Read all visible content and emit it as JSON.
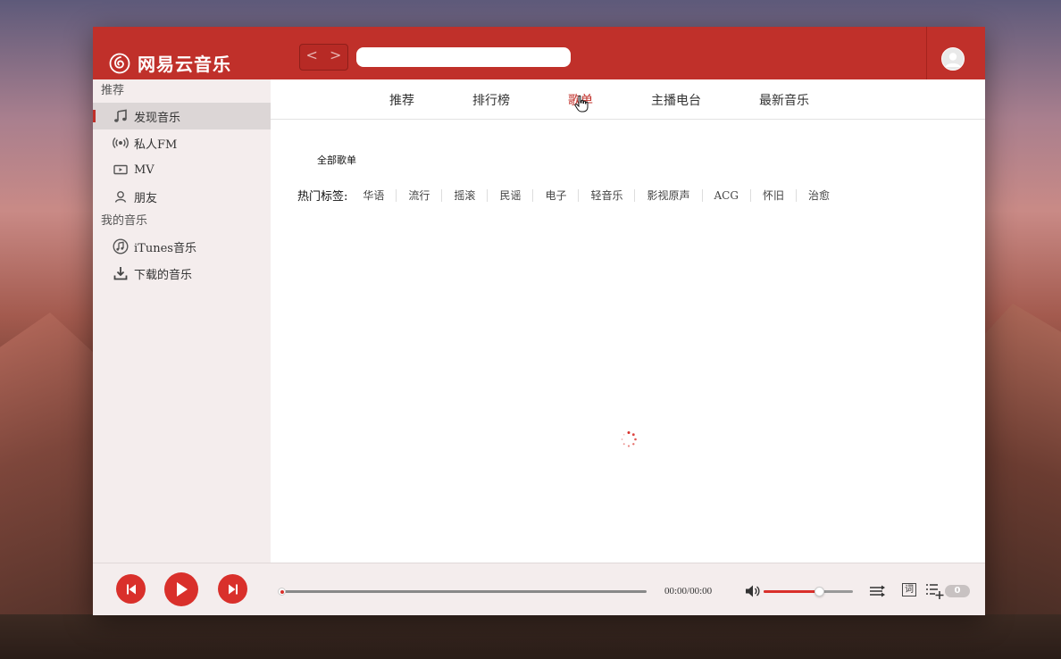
{
  "app": {
    "title": "网易云音乐"
  },
  "header": {
    "nav_back": "<",
    "nav_forward": ">",
    "search": {
      "value": "",
      "placeholder": ""
    }
  },
  "sidebar": {
    "section_recommend": "推荐",
    "recommend_items": [
      {
        "label": "发现音乐",
        "icon": "music-note-icon",
        "active": true
      },
      {
        "label": "私人FM",
        "icon": "radio-icon",
        "active": false
      },
      {
        "label": "MV",
        "icon": "video-icon",
        "active": false
      },
      {
        "label": "朋友",
        "icon": "friends-icon",
        "active": false
      }
    ],
    "section_my_music": "我的音乐",
    "my_music_items": [
      {
        "label": "iTunes音乐",
        "icon": "itunes-icon"
      },
      {
        "label": "下载的音乐",
        "icon": "download-icon"
      }
    ]
  },
  "tabs": [
    {
      "label": "推荐",
      "active": false
    },
    {
      "label": "排行榜",
      "active": false
    },
    {
      "label": "歌单",
      "active": true
    },
    {
      "label": "主播电台",
      "active": false
    },
    {
      "label": "最新音乐",
      "active": false
    }
  ],
  "playlist": {
    "all_label": "全部歌单",
    "hot_tags_label": "热门标签:",
    "hot_tags": [
      "华语",
      "流行",
      "摇滚",
      "民谣",
      "电子",
      "轻音乐",
      "影视原声",
      "ACG",
      "怀旧",
      "治愈"
    ]
  },
  "player": {
    "time": "00:00/00:00",
    "progress": 0,
    "volume": 0.62,
    "playlist_count": "0",
    "lyrics_label": "词"
  },
  "colors": {
    "brand": "#c0302a",
    "sidebar_bg": "#f4eded"
  }
}
